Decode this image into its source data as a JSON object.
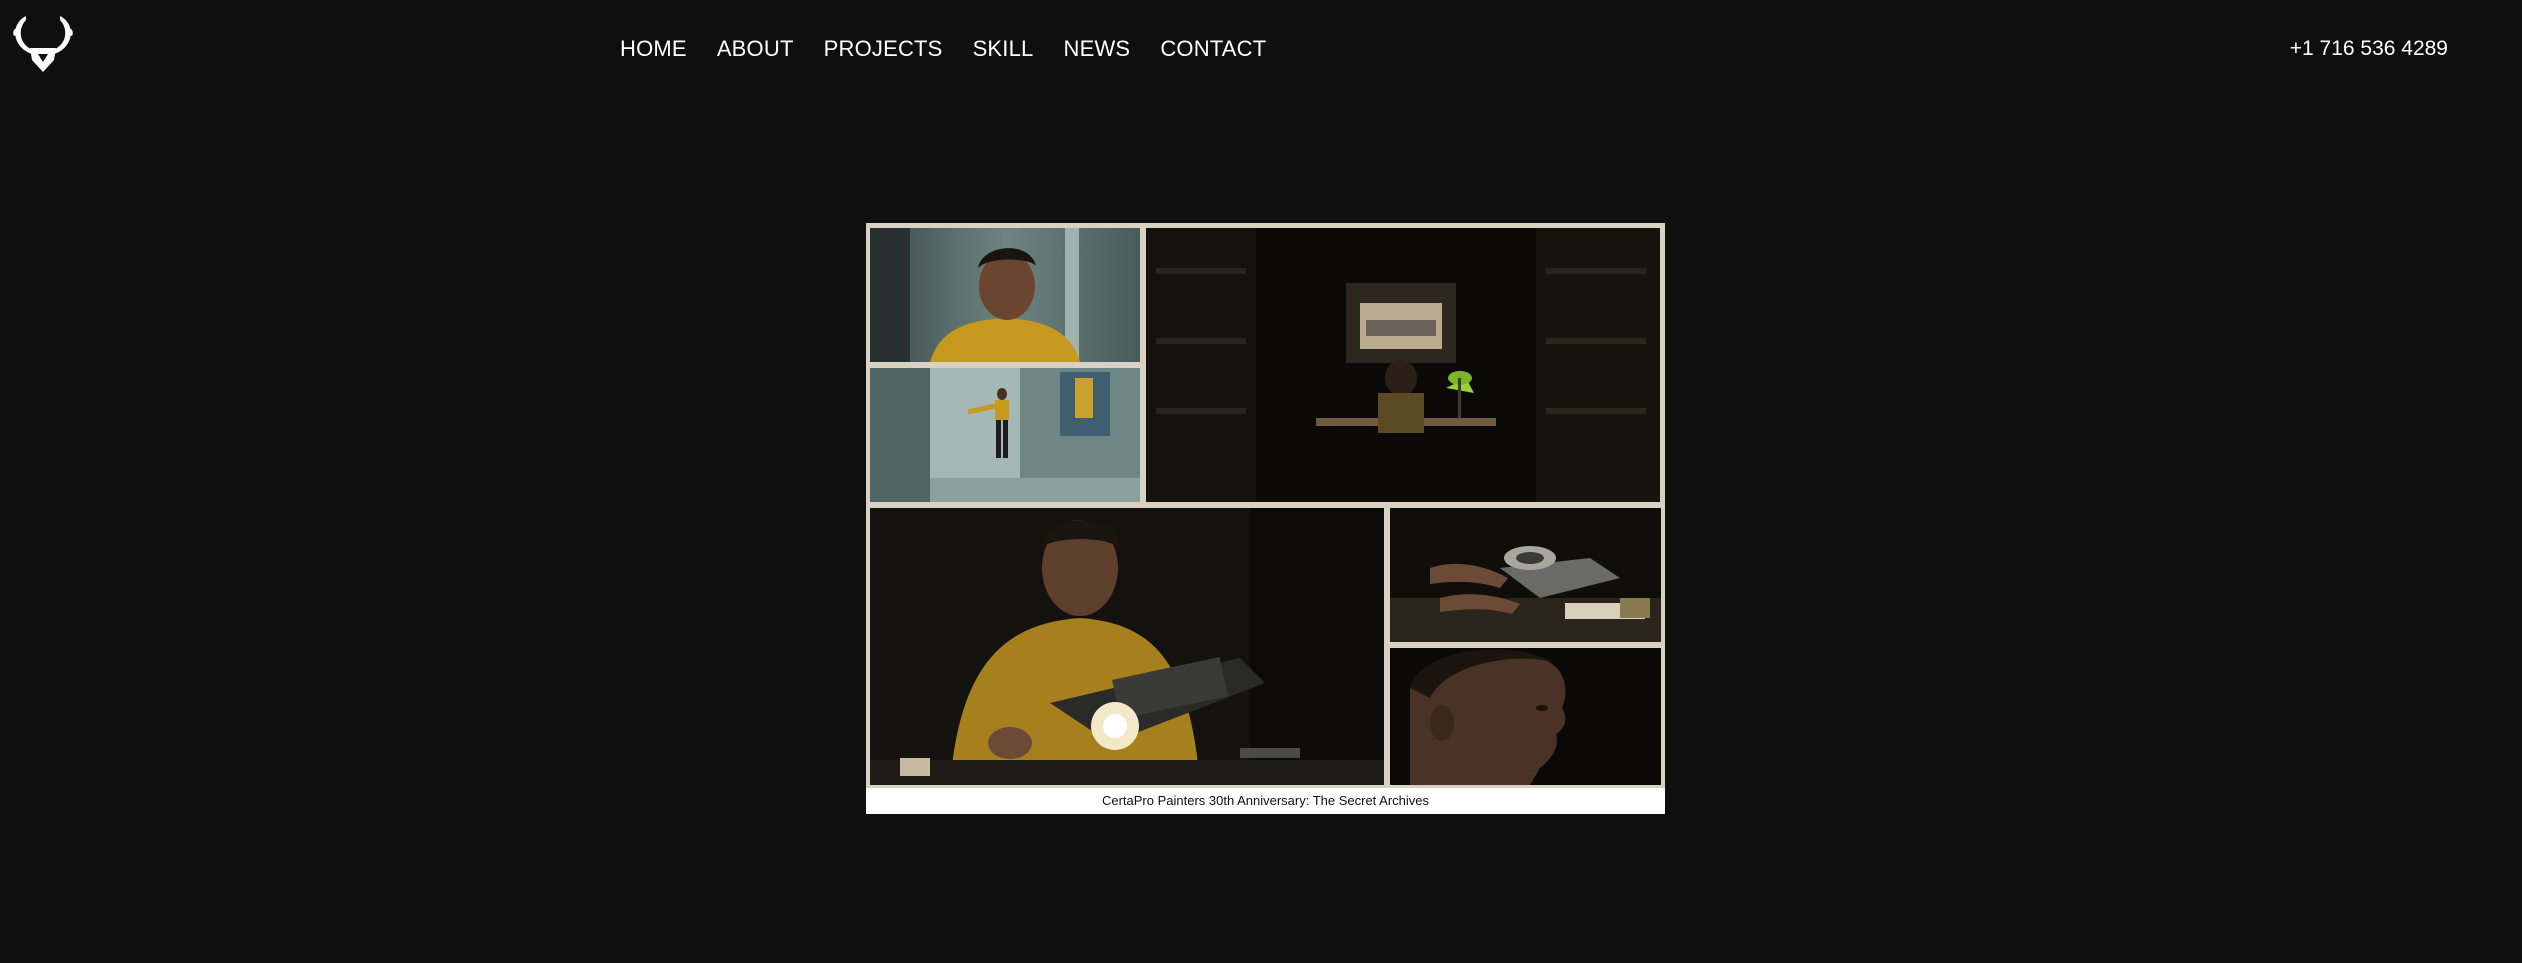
{
  "header": {
    "logo_icon": "antlers-shield-logo-icon",
    "nav": [
      {
        "label": "HOME"
      },
      {
        "label": "ABOUT"
      },
      {
        "label": "PROJECTS"
      },
      {
        "label": "SKILL"
      },
      {
        "label": "NEWS"
      },
      {
        "label": "CONTACT"
      }
    ],
    "phone": "+1 716 536 4289"
  },
  "project": {
    "caption": "CertaPro Painters 30th Anniversary: The Secret Archives",
    "tiles": [
      {
        "icon": "man-yellow-shirt-closeup-image"
      },
      {
        "icon": "man-in-hallway-image"
      },
      {
        "icon": "archive-room-desk-image"
      },
      {
        "icon": "man-with-projector-image"
      },
      {
        "icon": "hands-on-film-reel-image"
      },
      {
        "icon": "face-profile-closeup-image"
      }
    ]
  },
  "colors": {
    "background": "#0f0f0f",
    "text": "#ffffff",
    "accent_yellow": "#c9a227",
    "lamp_green": "#9ad13a"
  }
}
